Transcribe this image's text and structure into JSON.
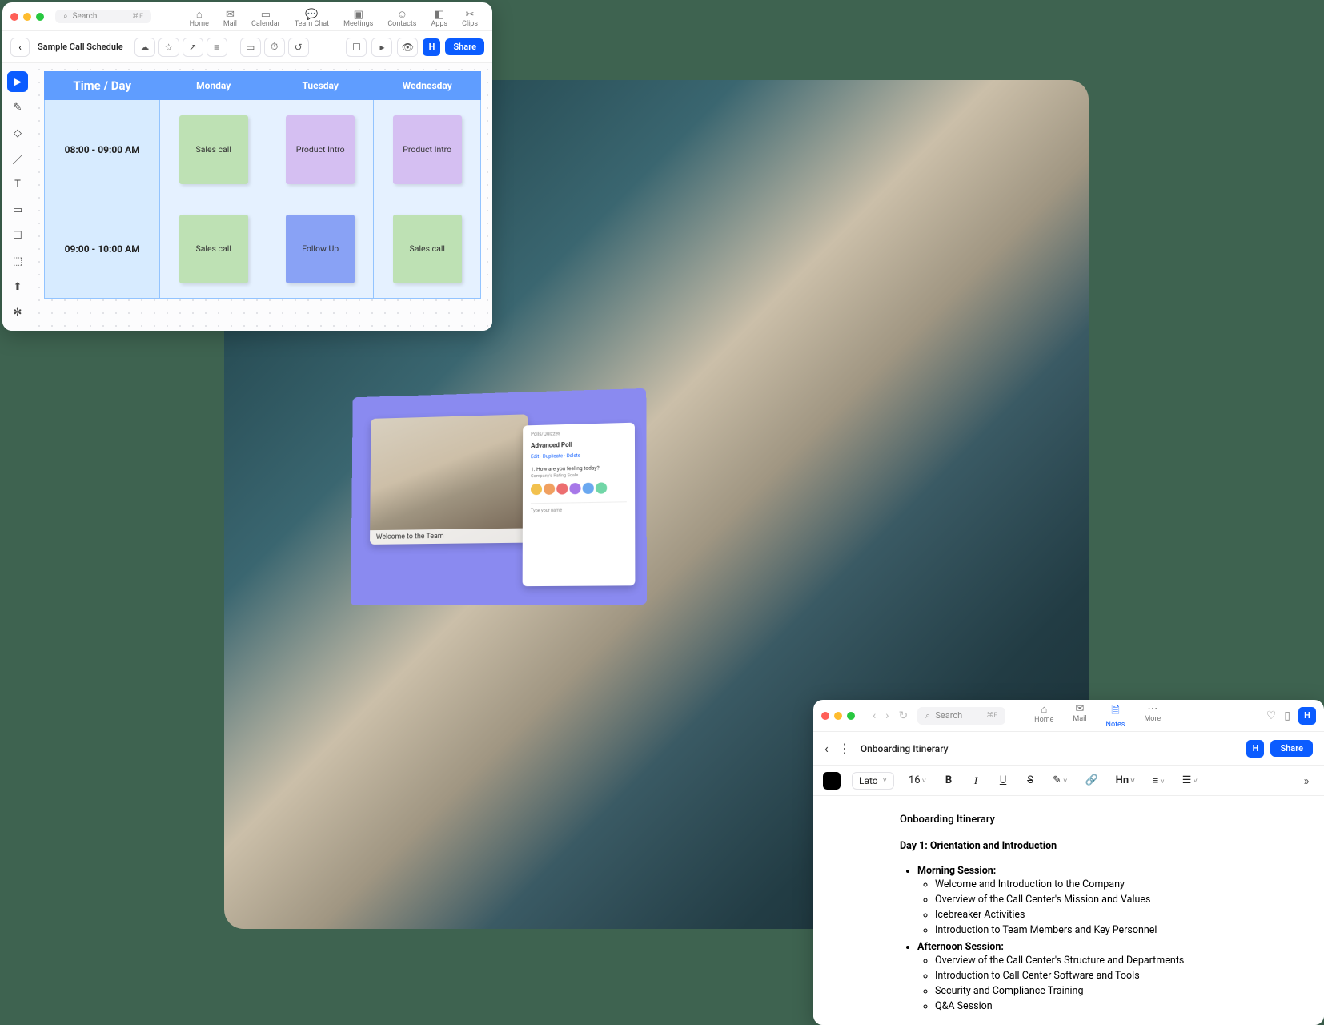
{
  "whiteboard": {
    "search_placeholder": "Search",
    "search_kbd": "⌘F",
    "nav": [
      {
        "icon": "⌂",
        "label": "Home"
      },
      {
        "icon": "✉",
        "label": "Mail"
      },
      {
        "icon": "▭",
        "label": "Calendar"
      },
      {
        "icon": "💬",
        "label": "Team Chat"
      },
      {
        "icon": "▣",
        "label": "Meetings"
      },
      {
        "icon": "☺",
        "label": "Contacts"
      },
      {
        "icon": "◧",
        "label": "Apps"
      },
      {
        "icon": "✂",
        "label": "Clips"
      }
    ],
    "doc_title": "Sample Call Schedule",
    "share_label": "Share",
    "avatar": "H",
    "schedule": {
      "header": [
        "Time / Day",
        "Monday",
        "Tuesday",
        "Wednesday"
      ],
      "rows": [
        {
          "time": "08:00 - 09:00 AM",
          "cells": [
            {
              "text": "Sales call",
              "color": "green"
            },
            {
              "text": "Product Intro",
              "color": "purple"
            },
            {
              "text": "Product Intro",
              "color": "purple"
            }
          ]
        },
        {
          "time": "09:00 - 10:00 AM",
          "cells": [
            {
              "text": "Sales call",
              "color": "green"
            },
            {
              "text": "Follow Up",
              "color": "blue"
            },
            {
              "text": "Sales call",
              "color": "green"
            }
          ]
        }
      ]
    }
  },
  "monitor": {
    "video_caption": "Welcome to the Team",
    "poll": {
      "breadcrumb": "Polls/Quizzes",
      "title": "Advanced Poll",
      "link_edit": "Edit",
      "link_dup": "Duplicate",
      "link_del": "Delete",
      "question": "1. How are you feeling today?",
      "subtitle": "Company's Rating Scale",
      "footer": "Type your name"
    },
    "av_colors": [
      "#f2c14e",
      "#f0a060",
      "#ec6e70",
      "#a778e8",
      "#6aa8f0",
      "#71d6a7"
    ]
  },
  "notes": {
    "search_placeholder": "Search",
    "search_kbd": "⌘F",
    "tabs": [
      {
        "icon": "⌂",
        "label": "Home"
      },
      {
        "icon": "✉",
        "label": "Mail"
      },
      {
        "icon": "🗎",
        "label": "Notes"
      },
      {
        "icon": "⋯",
        "label": "More"
      }
    ],
    "active_tab_index": 2,
    "avatar": "H",
    "doc_title": "Onboarding Itinerary",
    "share_label": "Share",
    "toolbar": {
      "font": "Lato",
      "size": "16",
      "heading": "Hn"
    },
    "body": {
      "title": "Onboarding Itinerary",
      "day_heading": "Day 1: Orientation and Introduction",
      "sessions": [
        {
          "label": "Morning Session:",
          "items": [
            "Welcome and Introduction to the Company",
            "Overview of the Call Center's Mission and Values",
            "Icebreaker Activities",
            "Introduction to Team Members and Key Personnel"
          ]
        },
        {
          "label": "Afternoon Session:",
          "items": [
            "Overview of the Call Center's Structure and Departments",
            "Introduction to Call Center Software and Tools",
            "Security and Compliance Training",
            "Q&A Session"
          ]
        }
      ]
    }
  }
}
